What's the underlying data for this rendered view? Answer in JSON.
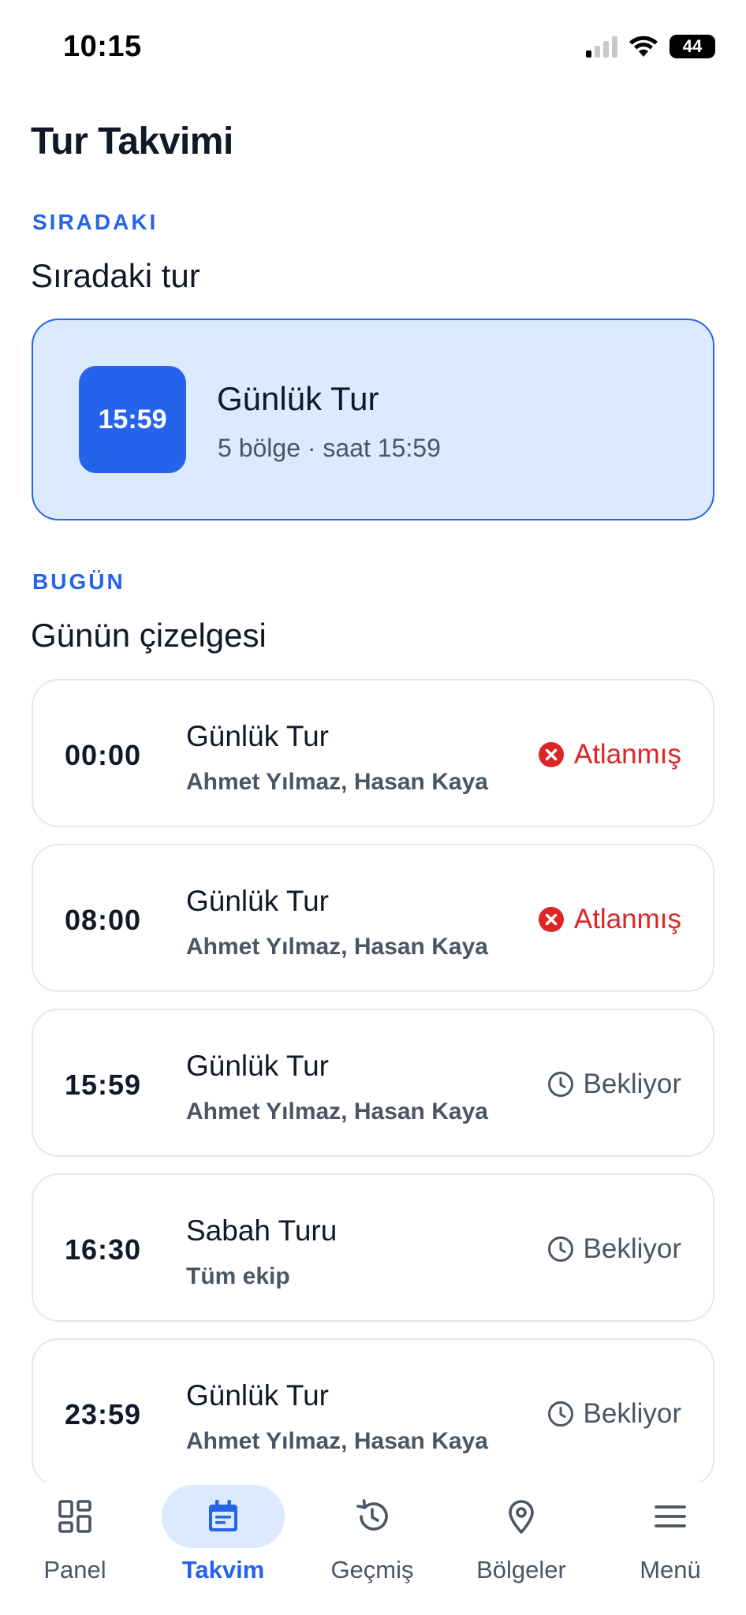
{
  "status_bar": {
    "time": "10:15",
    "battery": "44"
  },
  "page": {
    "title": "Tur Takvimi"
  },
  "next_section": {
    "eyebrow": "SIRADAKI",
    "title": "Sıradaki tur",
    "card": {
      "time": "15:59",
      "name": "Günlük Tur",
      "subtitle": "5 bölge · saat 15:59"
    }
  },
  "today_section": {
    "eyebrow": "BUGÜN",
    "title": "Günün çizelgesi",
    "rows": [
      {
        "time": "00:00",
        "name": "Günlük Tur",
        "people": "Ahmet Yılmaz, Hasan Kaya",
        "status": "Atlanmış",
        "status_type": "skipped",
        "icon": "x-circle-icon"
      },
      {
        "time": "08:00",
        "name": "Günlük Tur",
        "people": "Ahmet Yılmaz, Hasan Kaya",
        "status": "Atlanmış",
        "status_type": "skipped",
        "icon": "x-circle-icon"
      },
      {
        "time": "15:59",
        "name": "Günlük Tur",
        "people": "Ahmet Yılmaz, Hasan Kaya",
        "status": "Bekliyor",
        "status_type": "waiting",
        "icon": "clock-icon"
      },
      {
        "time": "16:30",
        "name": "Sabah Turu",
        "people": "Tüm ekip",
        "status": "Bekliyor",
        "status_type": "waiting",
        "icon": "clock-icon"
      },
      {
        "time": "23:59",
        "name": "Günlük Tur",
        "people": "Ahmet Yılmaz, Hasan Kaya",
        "status": "Bekliyor",
        "status_type": "waiting",
        "icon": "clock-icon"
      }
    ]
  },
  "bottom_nav": {
    "items": [
      {
        "label": "Panel",
        "icon": "dashboard-icon",
        "active": false
      },
      {
        "label": "Takvim",
        "icon": "calendar-icon",
        "active": true
      },
      {
        "label": "Geçmiş",
        "icon": "history-icon",
        "active": false
      },
      {
        "label": "Bölgeler",
        "icon": "location-pin-icon",
        "active": false
      },
      {
        "label": "Menü",
        "icon": "menu-icon",
        "active": false
      }
    ]
  },
  "colors": {
    "accent": "#2563eb",
    "accent_light": "#dbeafe",
    "skipped": "#dc2626",
    "muted": "#4b5563"
  }
}
